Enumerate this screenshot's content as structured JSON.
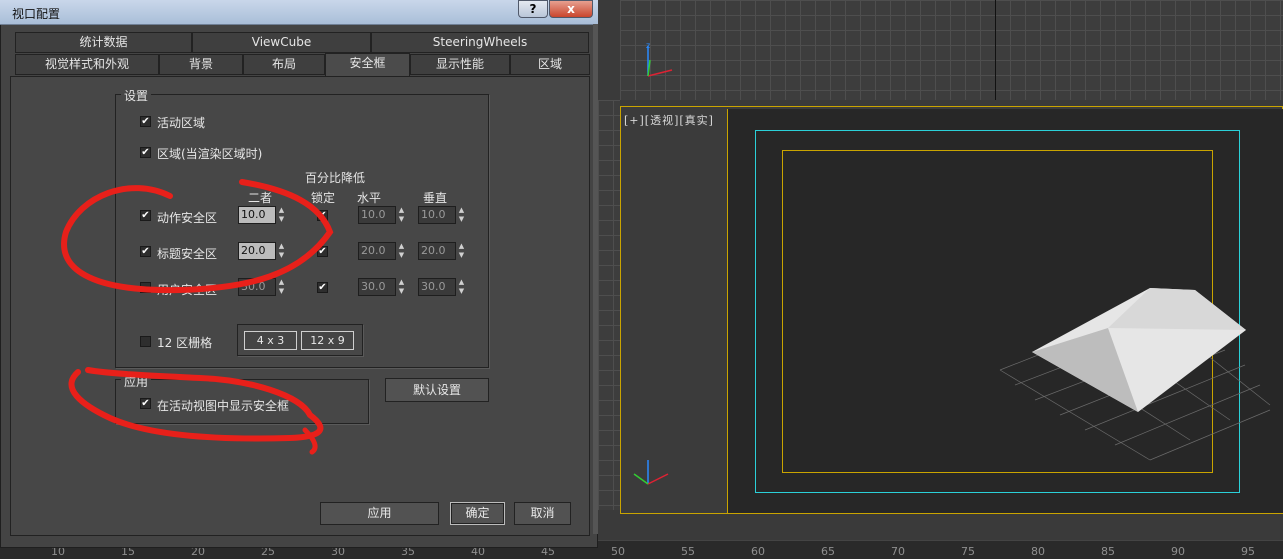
{
  "dialog": {
    "title": "视口配置",
    "help_label": "?",
    "close_label": "x",
    "tabs_row1": [
      "统计数据",
      "ViewCube",
      "SteeringWheels"
    ],
    "tabs_row2": [
      "视觉样式和外观",
      "背景",
      "布局",
      "安全框",
      "显示性能",
      "区域"
    ],
    "selected_tab": "安全框"
  },
  "settings": {
    "group_title": "设置",
    "live_area": {
      "label": "活动区域",
      "checked": true
    },
    "region": {
      "label": "区域(当渲染区域时)",
      "checked": true
    },
    "col_percent": "百分比降低",
    "col_both": "二者",
    "col_lock": "锁定",
    "col_horizontal": "水平",
    "col_vertical": "垂直",
    "rows": [
      {
        "label": "动作安全区",
        "checked": true,
        "both": "10.0",
        "lock": true,
        "h": "10.0",
        "v": "10.0"
      },
      {
        "label": "标题安全区",
        "checked": true,
        "both": "20.0",
        "lock": true,
        "h": "20.0",
        "v": "20.0"
      },
      {
        "label": "用户安全区",
        "checked": false,
        "both": "30.0",
        "lock": true,
        "h": "30.0",
        "v": "30.0"
      }
    ],
    "grid12": {
      "label": "12 区栅格",
      "checked": false
    },
    "ratio_4x3": "4 x 3",
    "ratio_12x9": "12 x 9"
  },
  "apply_group": {
    "title": "应用",
    "show_in_active": {
      "label": "在活动视图中显示安全框",
      "checked": true
    }
  },
  "buttons": {
    "defaults": "默认设置",
    "apply": "应用",
    "ok": "确定",
    "cancel": "取消"
  },
  "viewport": {
    "label": "[+][透视][真实]",
    "frame_colors": {
      "outer": "#c9a400",
      "action": "#2bd0d8",
      "title": "#c9a400"
    }
  },
  "ruler": {
    "ticks": [
      "10",
      "15",
      "20",
      "25",
      "30",
      "35",
      "40",
      "45",
      "50",
      "55",
      "60",
      "65",
      "70",
      "75",
      "80",
      "85",
      "90",
      "95"
    ]
  },
  "annotation_color": "#e8201a"
}
